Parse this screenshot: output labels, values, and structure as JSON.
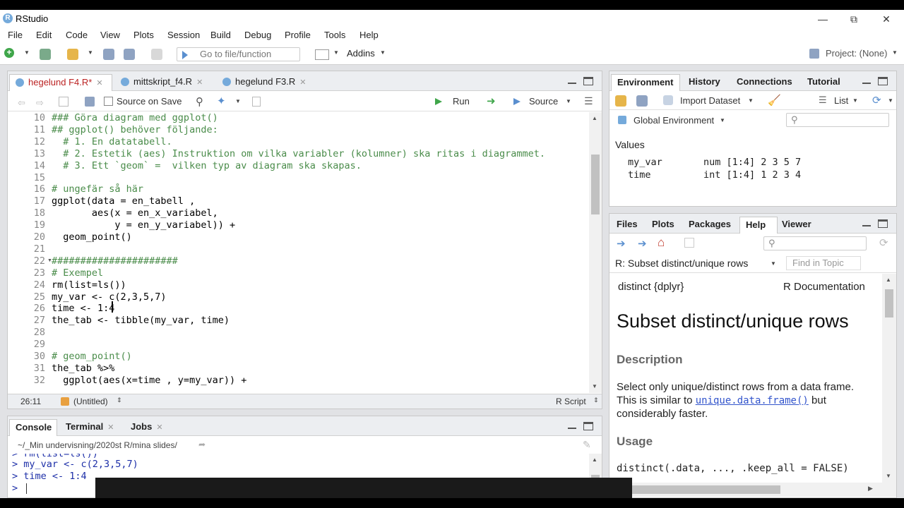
{
  "window": {
    "title": "RStudio",
    "logo": "R"
  },
  "menubar": [
    "File",
    "Edit",
    "Code",
    "View",
    "Plots",
    "Session",
    "Build",
    "Debug",
    "Profile",
    "Tools",
    "Help"
  ],
  "toolbar": {
    "goto_placeholder": "Go to file/function",
    "addins": "Addins",
    "project": "Project: (None)"
  },
  "editor": {
    "tabs": [
      {
        "label": "hegelund F4.R*",
        "active": true
      },
      {
        "label": "mittskript_f4.R",
        "active": false
      },
      {
        "label": "hegelund F3.R",
        "active": false
      }
    ],
    "source_on_save": "Source on Save",
    "run": "Run",
    "source": "Source",
    "lines": [
      {
        "n": "10",
        "text": "### Göra diagram med ggplot()",
        "type": "cmt"
      },
      {
        "n": "11",
        "text": "## ggplot() behöver följande:",
        "type": "cmt"
      },
      {
        "n": "12",
        "text": "  # 1. En datatabell.",
        "type": "cmt"
      },
      {
        "n": "13",
        "text": "  # 2. Estetik (aes) Instruktion om vilka variabler (kolumner) ska ritas i diagrammet.",
        "type": "cmt"
      },
      {
        "n": "14",
        "text": "  # 3. Ett `geom` =  vilken typ av diagram ska skapas.",
        "type": "cmt"
      },
      {
        "n": "15",
        "text": "",
        "type": "code"
      },
      {
        "n": "16",
        "text": "# ungefär så här",
        "type": "cmt"
      },
      {
        "n": "17",
        "text": "ggplot(data = en_tabell ,",
        "type": "code"
      },
      {
        "n": "18",
        "text": "       aes(x = en_x_variabel,",
        "type": "code"
      },
      {
        "n": "19",
        "text": "           y = en_y_variabel)) +",
        "type": "code"
      },
      {
        "n": "20",
        "text": "  geom_point()",
        "type": "code"
      },
      {
        "n": "21",
        "text": "",
        "type": "code"
      },
      {
        "n": "22",
        "text": "######################",
        "type": "cmt",
        "fold": true
      },
      {
        "n": "23",
        "text": "# Exempel",
        "type": "cmt"
      },
      {
        "n": "24",
        "text": "rm(list=ls())",
        "type": "code"
      },
      {
        "n": "25",
        "text": "my_var <- c(2,3,5,7)",
        "type": "code"
      },
      {
        "n": "26",
        "text": "time <- 1:4",
        "type": "code"
      },
      {
        "n": "27",
        "text": "the_tab <- tibble(my_var, time)",
        "type": "code"
      },
      {
        "n": "28",
        "text": "",
        "type": "code"
      },
      {
        "n": "29",
        "text": "",
        "type": "code"
      },
      {
        "n": "30",
        "text": "# geom_point()",
        "type": "cmt"
      },
      {
        "n": "31",
        "text": "the_tab %>%",
        "type": "code"
      },
      {
        "n": "32",
        "text": "  ggplot(aes(x=time , y=my_var)) +",
        "type": "code"
      }
    ],
    "status_pos": "26:11",
    "status_scope": "(Untitled)",
    "status_type": "R Script"
  },
  "console": {
    "tabs": [
      "Console",
      "Terminal",
      "Jobs"
    ],
    "path": "~/_Min undervisning/2020st R/mina slides/",
    "lines": [
      "> rm(list=ls())",
      "> my_var <- c(2,3,5,7)",
      "> time <- 1:4",
      "> "
    ]
  },
  "environment": {
    "tabs": [
      "Environment",
      "History",
      "Connections",
      "Tutorial"
    ],
    "import_dataset": "Import Dataset",
    "list_label": "List",
    "global_env": "Global Environment",
    "values_header": "Values",
    "vars": [
      {
        "name": "my_var",
        "value": "num [1:4] 2 3 5 7"
      },
      {
        "name": "time",
        "value": "int [1:4] 1 2 3 4"
      }
    ]
  },
  "help": {
    "tabs": [
      "Files",
      "Plots",
      "Packages",
      "Help",
      "Viewer"
    ],
    "topic_title": "R: Subset distinct/unique rows",
    "find_placeholder": "Find in Topic",
    "pkg": "distinct {dplyr}",
    "rdoc": "R Documentation",
    "heading": "Subset distinct/unique rows",
    "desc_heading": "Description",
    "desc_text_1": "Select only unique/distinct rows from a data frame.",
    "desc_text_2a": "This is similar to ",
    "desc_link": "unique.data.frame()",
    "desc_text_2b": " but",
    "desc_text_3": "considerably faster.",
    "usage_heading": "Usage",
    "usage_code": "distinct(.data, ..., .keep_all = FALSE)"
  }
}
